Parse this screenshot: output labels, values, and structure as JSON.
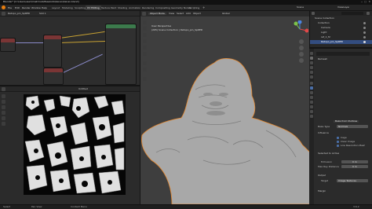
{
  "window": {
    "title": "Blender* [C:\\Users\\user\\OneDrive\\Masaüstü\\kenan\\kenan.blend]"
  },
  "menus": [
    "File",
    "Edit",
    "Render",
    "Window",
    "Help"
  ],
  "workspaces": [
    "Layout",
    "Modeling",
    "Sculpting",
    "UV Editing",
    "Texture Paint",
    "Shading",
    "Animation",
    "Rendering",
    "Compositing",
    "Geometry Nodes",
    "Scripting"
  ],
  "active_workspace": "UV Editing",
  "scene": {
    "label": "Scene",
    "view_layer": "ViewLayer"
  },
  "node_editor": {
    "object": "Retopo_pin_SpRED",
    "slot": "Slot 1"
  },
  "image_editor": {
    "image_name": "Untitled"
  },
  "viewport": {
    "mode": "Object Mode",
    "menus": [
      "View",
      "Select",
      "Add",
      "Object"
    ],
    "orientation": "Global",
    "info_line1": "User Perspective",
    "info_line2": "(265) Scene Collection | Retopo_pin_SpRED"
  },
  "outliner": {
    "title": "Scene Collection",
    "rows": [
      "Collection",
      "Camera",
      "Light",
      "ref_1_f2",
      "Retopo_pin_SpRED"
    ]
  },
  "properties": {
    "modifier_name": "Remesh",
    "header": "Bake from Multires",
    "bake_type_label": "Bake Type",
    "bake_type_value": "Normals",
    "sections": [
      "Influence",
      "Selected to Active",
      "Output",
      "Margin"
    ],
    "options": [
      "Cage",
      "Clear Image",
      "Low Resolution Mesh"
    ],
    "fields": [
      {
        "label": "Extrusion",
        "value": "0 m"
      },
      {
        "label": "Max Ray Distance",
        "value": "0 m"
      },
      {
        "label": "Target",
        "value": "Image Textures"
      }
    ]
  },
  "statusbar": {
    "left": "Select",
    "mid": "Pan View",
    "right": "Context Menu",
    "version": "3.6.2"
  },
  "colors": {
    "accent_orange": "#e8892e",
    "wire_yellow": "#c8a233",
    "node_green": "#3c7a4c",
    "node_red": "#7a3535",
    "selection_blue": "#4a6fa8"
  }
}
